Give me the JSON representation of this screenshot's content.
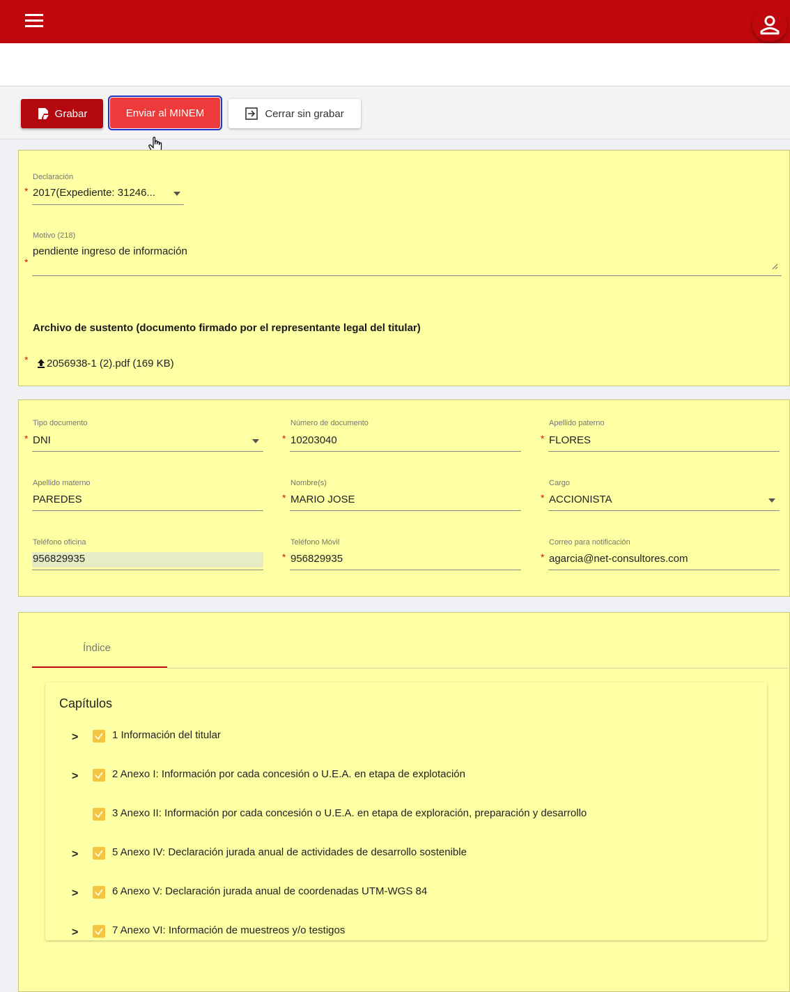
{
  "toolbar": {
    "save_label": "Grabar",
    "send_label": "Enviar al MINEM",
    "close_label": "Cerrar sin grabar"
  },
  "declaration": {
    "label": "Declaración",
    "value": "2017(Expediente: 31246...",
    "motivo_label": "Motivo (218)",
    "motivo_value": "pendiente ingreso de información",
    "archivo_title": "Archivo de sustento (documento firmado por el representante legal del titular)",
    "archivo_file": "2056938-1 (2).pdf (169 KB)"
  },
  "representative": {
    "tipo_documento": {
      "label": "Tipo documento",
      "value": "DNI"
    },
    "numero_documento": {
      "label": "Número de documento",
      "value": "10203040"
    },
    "apellido_paterno": {
      "label": "Apellido paterno",
      "value": "FLORES"
    },
    "apellido_materno": {
      "label": "Apellido materno",
      "value": "PAREDES"
    },
    "nombres": {
      "label": "Nombre(s)",
      "value": "MARIO JOSE"
    },
    "cargo": {
      "label": "Cargo",
      "value": "ACCIONISTA"
    },
    "telefono_oficina": {
      "label": "Teléfono oficina",
      "value": "956829935"
    },
    "telefono_movil": {
      "label": "Teléfono Móvil",
      "value": "956829935"
    },
    "correo": {
      "label": "Correo para notificación",
      "value": "agarcia@net-consultores.com"
    }
  },
  "index": {
    "tab_label": "Índice",
    "chapters_title": "Capítulos",
    "chapters": [
      {
        "label": "1 Información del titular",
        "expandable": true,
        "checked": true
      },
      {
        "label": "2 Anexo I: Información por cada concesión o U.E.A. en etapa de explotación",
        "expandable": true,
        "checked": true
      },
      {
        "label": "3 Anexo II: Información por cada concesión o U.E.A. en etapa de exploración, preparación y desarrollo",
        "expandable": false,
        "checked": true
      },
      {
        "label": "5 Anexo IV: Declaración jurada anual de actividades de desarrollo sostenible",
        "expandable": true,
        "checked": true
      },
      {
        "label": "6 Anexo V: Declaración jurada anual de coordenadas UTM-WGS 84",
        "expandable": true,
        "checked": true
      },
      {
        "label": "7 Anexo VI: Información de muestreos y/o testigos",
        "expandable": true,
        "checked": true
      }
    ]
  },
  "colors": {
    "brand": "#c0080c",
    "send_button": "#ee3a3a",
    "card_background": "#ffffa4",
    "checkbox": "#f5c542"
  },
  "required_mark": "*"
}
